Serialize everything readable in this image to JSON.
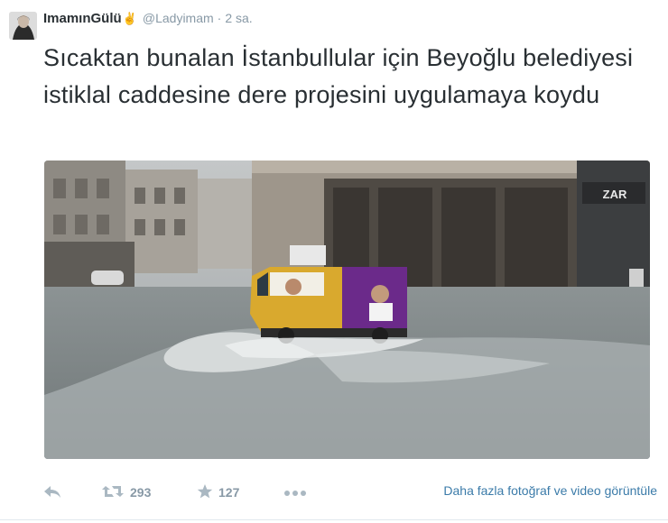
{
  "tweet": {
    "display_name": "ImamınGülü",
    "name_symbol": "✌",
    "handle": "@Ladyimam",
    "separator": "·",
    "time": "2 sa.",
    "text": "Sıcaktan bunalan İstanbullular için Beyoğlu belediyesi istiklal caddesine dere projesini uygulamaya koydu",
    "photo": {
      "storefront_sign": "ZAR",
      "description_icon": "photo-icon"
    }
  },
  "actions": {
    "reply_icon": "reply-icon",
    "retweet_icon": "retweet-icon",
    "retweet_count": "293",
    "favorite_icon": "star-icon",
    "favorite_count": "127",
    "more_icon": "more-icon",
    "media_link": "Daha fazla fotoğraf ve video görüntüle"
  },
  "colors": {
    "text": "#292f33",
    "muted": "#8899a6",
    "link": "#3b7ba9",
    "border": "#e1e8ed"
  }
}
